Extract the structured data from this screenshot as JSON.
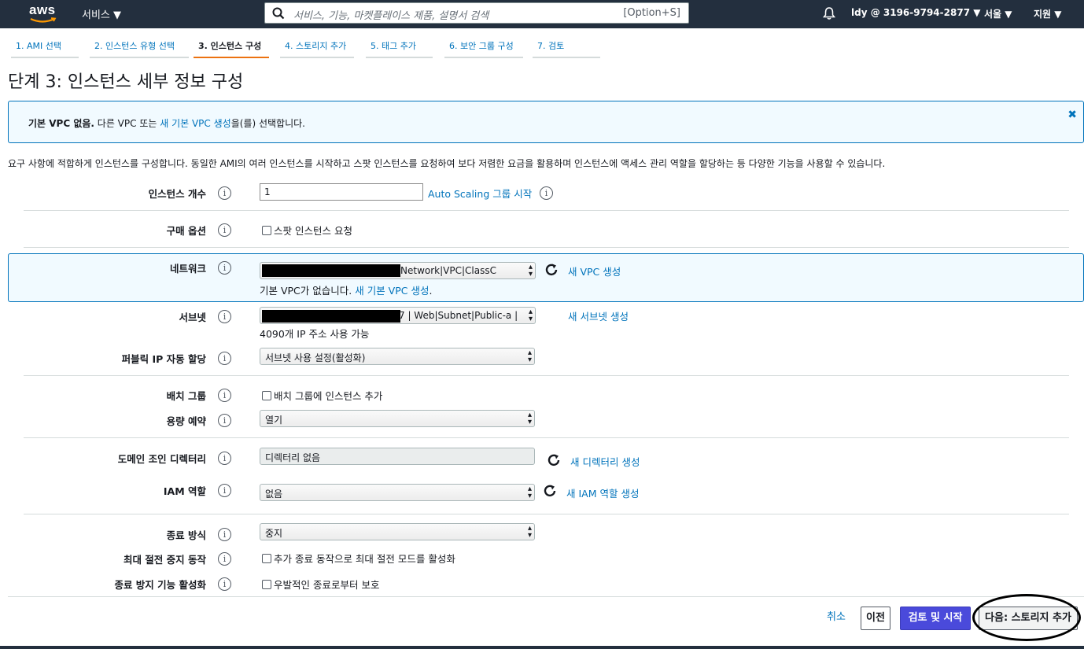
{
  "topnav": {
    "logo": "aws",
    "services": "서비스 ▼",
    "search_placeholder": "서비스, 기능, 마켓플레이스 제품, 설명서 검색",
    "search_hint": "[Option+S]",
    "account": "ldy @ 3196-9794-2877 ▼",
    "region": "서울 ▼",
    "support": "지원 ▼"
  },
  "steps": [
    "1. AMI 선택",
    "2. 인스턴스 유형 선택",
    "3. 인스턴스 구성",
    "4. 스토리지 추가",
    "5. 태그 추가",
    "6. 보안 그룹 구성",
    "7. 검토"
  ],
  "title": "단계 3: 인스턴스 세부 정보 구성",
  "alert": {
    "bold": "기본 VPC 없음.",
    "text1": " 다른 VPC 또는 ",
    "link": "새 기본 VPC 생성",
    "text2": "을(를) 선택합니다."
  },
  "description": "요구 사항에 적합하게 인스턴스를 구성합니다. 동일한 AMI의 여러 인스턴스를 시작하고 스팟 인스턴스를 요청하여 보다 저렴한 요금을 활용하며 인스턴스에 액세스 관리 역할을 할당하는 등 다양한 기능을 사용할 수 있습니다.",
  "form": {
    "instance_count": {
      "label": "인스턴스 개수",
      "value": "1",
      "link": "Auto Scaling 그룹 시작"
    },
    "purchase": {
      "label": "구매 옵션",
      "checkbox": "스팟 인스턴스 요청"
    },
    "network": {
      "label": "네트워크",
      "value": "Network|VPC|ClassC",
      "link": "새 VPC 생성",
      "note": "기본 VPC가 없습니다.",
      "note_link": "새 기본 VPC 생성",
      "note_end": "."
    },
    "subnet": {
      "label": "서브넷",
      "value": "7 | Web|Subnet|Public-a |",
      "link": "새 서브넷 생성",
      "note": "4090개 IP 주소 사용 가능"
    },
    "public_ip": {
      "label": "퍼블릭 IP 자동 할당",
      "value": "서브넷 사용 설정(활성화)"
    },
    "placement": {
      "label": "배치 그룹",
      "checkbox": "배치 그룹에 인스턴스 추가"
    },
    "capacity": {
      "label": "용량 예약",
      "value": "열기"
    },
    "domain": {
      "label": "도메인 조인 디렉터리",
      "value": "디렉터리 없음",
      "link": "새 디렉터리 생성"
    },
    "iam": {
      "label": "IAM 역할",
      "value": "없음",
      "link": "새 IAM 역할 생성"
    },
    "shutdown": {
      "label": "종료 방식",
      "value": "중지"
    },
    "hibernate": {
      "label": "최대 절전 중지 동작",
      "checkbox": "추가 종료 동작으로 최대 절전 모드를 활성화"
    },
    "termination": {
      "label": "종료 방지 기능 활성화",
      "checkbox": "우발적인 종료로부터 보호"
    }
  },
  "buttons": {
    "cancel": "취소",
    "previous": "이전",
    "review": "검토 및 시작",
    "next": "다음: 스토리지 추가"
  },
  "info_glyph": "i"
}
